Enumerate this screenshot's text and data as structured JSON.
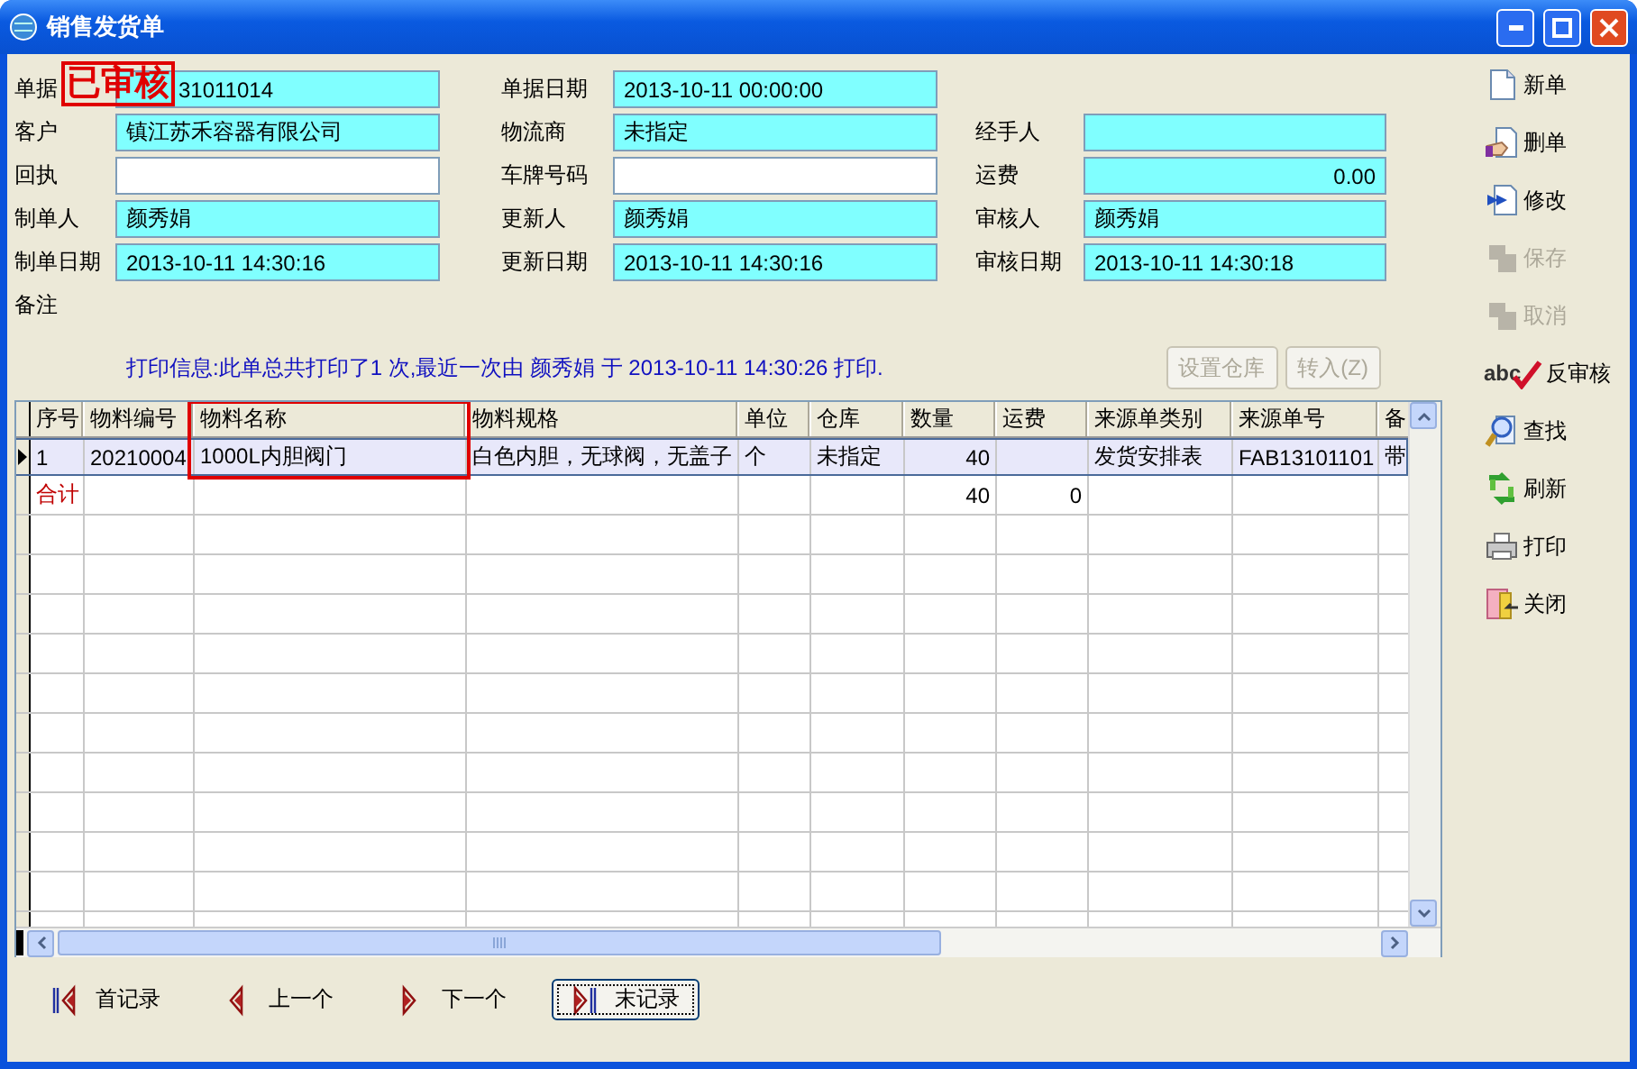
{
  "window": {
    "title": "销售发货单"
  },
  "stamp": {
    "text": "已审核"
  },
  "form_rows": [
    [
      {
        "label": "单据",
        "value": "31011014",
        "kind": "text"
      },
      {
        "label": "单据日期",
        "value": "2013-10-11 00:00:00",
        "kind": "text"
      }
    ],
    [
      {
        "label": "客户",
        "value": "镇江苏禾容器有限公司",
        "kind": "text"
      },
      {
        "label": "物流商",
        "value": "未指定",
        "kind": "text"
      },
      {
        "label": "经手人",
        "kind": "text"
      }
    ],
    [
      {
        "label": "回执",
        "kind": "blank"
      },
      {
        "label": "车牌号码",
        "kind": "blank"
      },
      {
        "label": "运费",
        "value": "0.00",
        "kind": "number"
      }
    ],
    [
      {
        "label": "制单人",
        "value": "颜秀娟",
        "kind": "text"
      },
      {
        "label": "更新人",
        "value": "颜秀娟",
        "kind": "text"
      },
      {
        "label": "审核人",
        "value": "颜秀娟",
        "kind": "text"
      }
    ],
    [
      {
        "label": "制单日期",
        "value": "2013-10-11 14:30:16",
        "kind": "text"
      },
      {
        "label": "更新日期",
        "value": "2013-10-11 14:30:16",
        "kind": "text"
      },
      {
        "label": "审核日期",
        "value": "2013-10-11 14:30:18",
        "kind": "text"
      }
    ],
    [
      {
        "label": "备注",
        "kind": "label"
      }
    ]
  ],
  "print_info": "打印信息:此单总共打印了1 次,最近一次由 颜秀娟 于 2013-10-11 14:30:26  打印.",
  "grid_buttons": [
    {
      "label": "设置仓库",
      "disabled": true
    },
    {
      "label": "转入(Z)",
      "disabled": true
    }
  ],
  "table": {
    "columns": [
      {
        "label": "序号",
        "kind": "text",
        "highlighted": false
      },
      {
        "label": "物料编号",
        "kind": "text",
        "highlighted": false
      },
      {
        "label": "物料名称",
        "kind": "text",
        "highlighted": true
      },
      {
        "label": "物料规格",
        "kind": "text",
        "highlighted": false
      },
      {
        "label": "单位",
        "kind": "text",
        "highlighted": false
      },
      {
        "label": "仓库",
        "kind": "text",
        "highlighted": false
      },
      {
        "label": "数量",
        "kind": "number",
        "highlighted": false
      },
      {
        "label": "运费",
        "kind": "number",
        "highlighted": false
      },
      {
        "label": "来源单类别",
        "kind": "text",
        "highlighted": false
      },
      {
        "label": "来源单号",
        "kind": "text",
        "highlighted": false
      },
      {
        "label": "备",
        "kind": "text",
        "highlighted": false
      }
    ],
    "rows": [
      {
        "kind": "item",
        "selected": true,
        "cells": [
          "1",
          "20210004",
          "1000L内胆阀门",
          "白色内胆，无球阀，无盖子",
          "个",
          "未指定",
          "40",
          null,
          "发货安排表",
          "FAB13101101",
          "带"
        ]
      },
      {
        "kind": "total",
        "selected": false,
        "cells": [
          "合计",
          null,
          null,
          null,
          null,
          null,
          "40",
          "0",
          null,
          null,
          null
        ]
      }
    ]
  },
  "toolbar": [
    {
      "label": "新单",
      "kind": "new",
      "disabled": false
    },
    {
      "label": "删单",
      "kind": "delete",
      "disabled": false
    },
    {
      "label": "修改",
      "kind": "edit",
      "disabled": false
    },
    {
      "label": "保存",
      "kind": "save",
      "disabled": true
    },
    {
      "label": "取消",
      "kind": "cancel",
      "disabled": true
    },
    {
      "label": "反审核",
      "kind": "unaudit",
      "badge": "abc",
      "disabled": false
    },
    {
      "label": "查找",
      "kind": "find",
      "disabled": false
    },
    {
      "label": "刷新",
      "kind": "refresh",
      "disabled": false
    },
    {
      "label": "打印",
      "kind": "print",
      "disabled": false
    },
    {
      "label": "关闭",
      "kind": "close",
      "disabled": false
    }
  ],
  "nav": [
    {
      "label": "首记录",
      "kind": "first",
      "focused": false
    },
    {
      "label": "上一个",
      "kind": "prev",
      "focused": false
    },
    {
      "label": "下一个",
      "kind": "next",
      "focused": false
    },
    {
      "label": "末记录",
      "kind": "last",
      "focused": true
    }
  ]
}
